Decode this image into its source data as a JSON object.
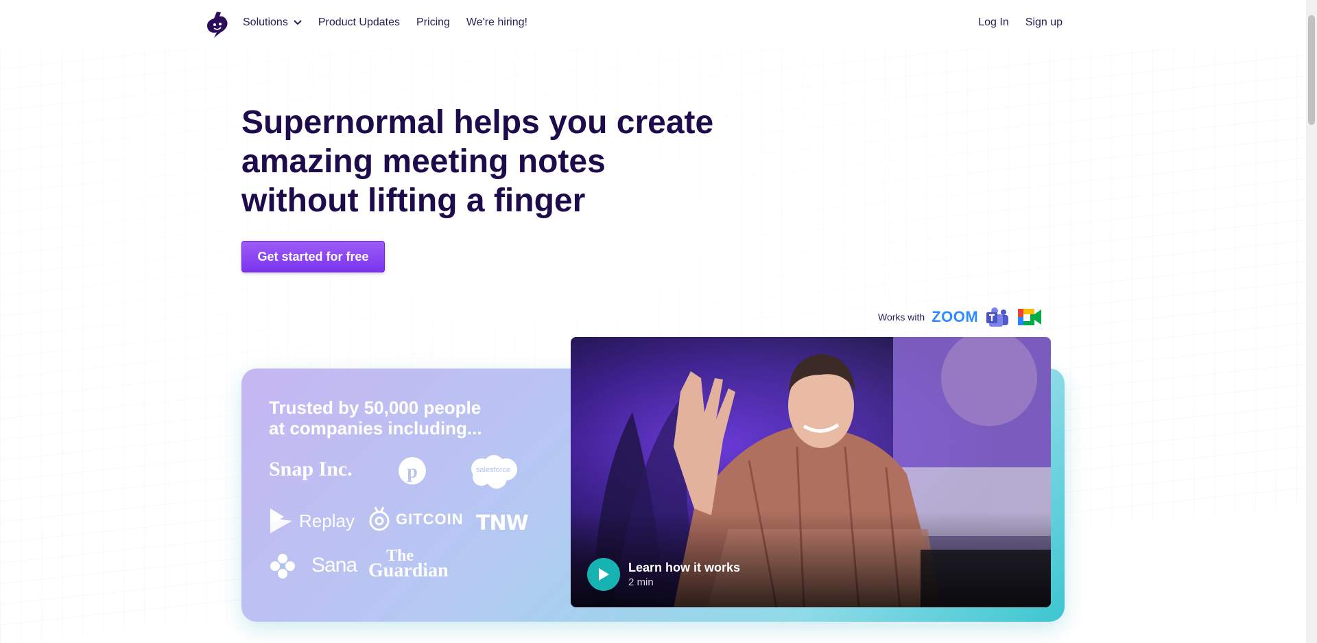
{
  "nav": {
    "links": [
      {
        "label": "Solutions",
        "has_dropdown": true
      },
      {
        "label": "Product Updates"
      },
      {
        "label": "Pricing"
      },
      {
        "label": "We're hiring!"
      }
    ],
    "login": "Log In",
    "signup": "Sign up"
  },
  "hero": {
    "headline_line1": "Supernormal helps you create",
    "headline_line2": "amazing meeting notes",
    "headline_line3": "without lifting a finger",
    "cta": "Get started for free"
  },
  "works_with": {
    "label": "Works with",
    "zoom": "ZOOM",
    "icons": [
      "zoom-logo",
      "teams-logo",
      "google-meet-logo"
    ]
  },
  "trusted": {
    "title_line1": "Trusted by 50,000 people",
    "title_line2": "at companies including...",
    "brands": {
      "snap": "Snap Inc.",
      "salesforce": "salesforce",
      "replay": "Replay",
      "gitcoin": "GITCOIN",
      "tnw": "TNW",
      "sana": "Sana",
      "guardian_1": "The",
      "guardian_2": "Guardian"
    }
  },
  "video": {
    "title": "Learn how it works",
    "duration": "2 min"
  },
  "colors": {
    "headline": "#1e0b4b",
    "cta": "#8b45f4",
    "play": "#17b3b3",
    "zoom": "#2d8cff"
  }
}
